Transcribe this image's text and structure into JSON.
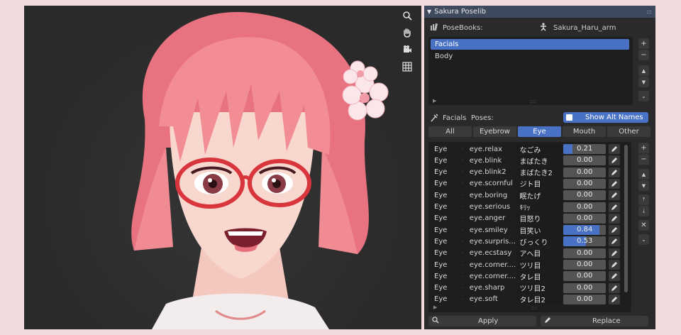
{
  "panel": {
    "title": "Sakura Poselib",
    "posebooks_label": "PoseBooks:",
    "armature_name": "Sakura_Haru_arm",
    "books": [
      {
        "label": "Facials",
        "selected": true
      },
      {
        "label": "Body",
        "selected": false
      }
    ],
    "facials_label": "Facials",
    "poses_label": "Poses:",
    "show_alt_names_label": "Show Alt Names",
    "tabs": [
      {
        "label": "All",
        "active": false
      },
      {
        "label": "Eyebrow",
        "active": false
      },
      {
        "label": "Eye",
        "active": true
      },
      {
        "label": "Mouth",
        "active": false
      },
      {
        "label": "Other",
        "active": false
      }
    ],
    "poses": [
      {
        "category": "Eye",
        "name": "eye.relax",
        "alt": "なごみ",
        "value": "0.21",
        "fraction": 0.21
      },
      {
        "category": "Eye",
        "name": "eye.blink",
        "alt": "まばたき",
        "value": "0.00",
        "fraction": 0
      },
      {
        "category": "Eye",
        "name": "eye.blink2",
        "alt": "まばたき2",
        "value": "0.00",
        "fraction": 0
      },
      {
        "category": "Eye",
        "name": "eye.scornful",
        "alt": "ジト目",
        "value": "0.00",
        "fraction": 0
      },
      {
        "category": "Eye",
        "name": "eye.boring",
        "alt": "眠たげ",
        "value": "0.00",
        "fraction": 0
      },
      {
        "category": "Eye",
        "name": "eye.serious",
        "alt": "ｷﾘｯ",
        "value": "0.00",
        "fraction": 0
      },
      {
        "category": "Eye",
        "name": "eye.anger",
        "alt": "目怒り",
        "value": "0.00",
        "fraction": 0
      },
      {
        "category": "Eye",
        "name": "eye.smiley",
        "alt": "目笑い",
        "value": "0.84",
        "fraction": 0.84
      },
      {
        "category": "Eye",
        "name": "eye.surpris...",
        "alt": "びっくり",
        "value": "0.53",
        "fraction": 0.53
      },
      {
        "category": "Eye",
        "name": "eye.ecstasy",
        "alt": "アヘ目",
        "value": "0.00",
        "fraction": 0
      },
      {
        "category": "Eye",
        "name": "eye.corner....",
        "alt": "ツリ目",
        "value": "0.00",
        "fraction": 0
      },
      {
        "category": "Eye",
        "name": "eye.corner....",
        "alt": "タレ目",
        "value": "0.00",
        "fraction": 0
      },
      {
        "category": "Eye",
        "name": "eye.sharp",
        "alt": "ツリ目2",
        "value": "0.00",
        "fraction": 0
      },
      {
        "category": "Eye",
        "name": "eye.soft",
        "alt": "タレ目2",
        "value": "0.00",
        "fraction": 0
      }
    ],
    "apply_label": "Apply",
    "replace_label": "Replace"
  },
  "viewport": {
    "tools": [
      "zoom-icon",
      "pan-hand-icon",
      "camera-icon",
      "grid-icon"
    ]
  },
  "colors": {
    "accent": "#4a72c4",
    "header": "#3d4a5e",
    "hair": "#f28c95"
  }
}
